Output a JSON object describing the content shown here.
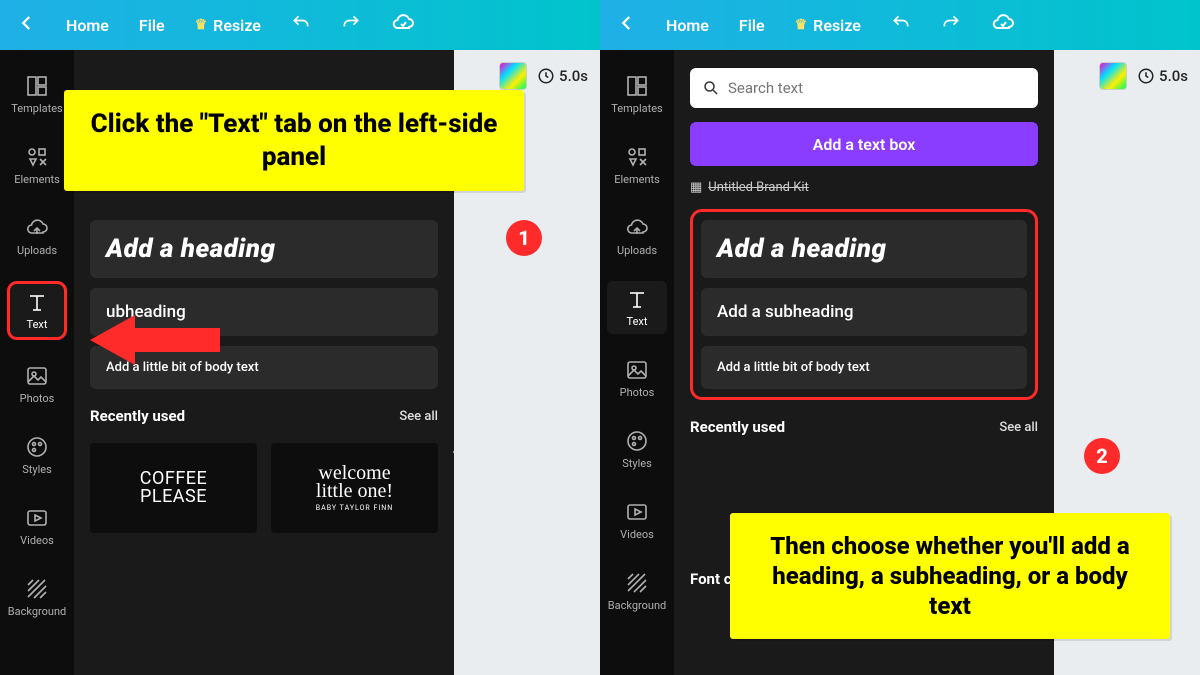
{
  "topbar": {
    "home": "Home",
    "file": "File",
    "resize": "Resize"
  },
  "sidebar": {
    "templates": "Templates",
    "elements": "Elements",
    "uploads": "Uploads",
    "text": "Text",
    "photos": "Photos",
    "styles": "Styles",
    "videos": "Videos",
    "background": "Background"
  },
  "textpanel": {
    "search_placeholder": "Search text",
    "add_text_box": "Add a text box",
    "brand_kit": "Untitled Brand Kit",
    "heading": "Add a heading",
    "subheading": "Add a subheading",
    "subheading_short": "ubheading",
    "body": "Add a little bit of body text",
    "recently_used": "Recently used",
    "see_all": "See all",
    "font_combinations": "Font combinations",
    "recent_cards": {
      "coffee_line1": "COFFEE",
      "coffee_line2": "PLEASE",
      "welcome_line1": "welcome",
      "welcome_line2": "little one!",
      "welcome_line3": "BABY TAYLOR FINN"
    }
  },
  "canvas": {
    "duration": "5.0s"
  },
  "callouts": {
    "step1": "Click the \"Text\" tab on the left-side panel",
    "step2": "Then choose whether you'll add a heading, a subheading, or a body text",
    "badge1": "1",
    "badge2": "2"
  }
}
